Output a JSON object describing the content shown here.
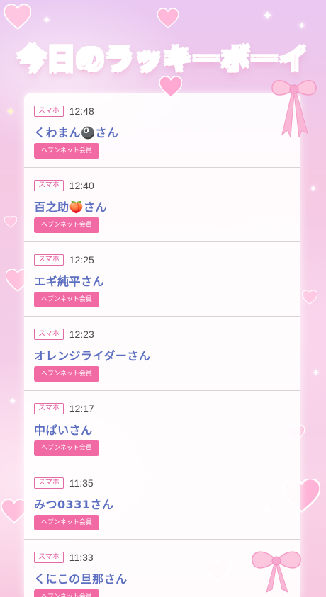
{
  "header": {
    "title": "今日のラッキーボーイ"
  },
  "entries": [
    {
      "device": "スマホ",
      "time": "12:48",
      "name": "くわまん🎱さん",
      "badge": "ヘブンネット会員"
    },
    {
      "device": "スマホ",
      "time": "12:40",
      "name": "百之助🍑さん",
      "badge": "ヘブンネット会員"
    },
    {
      "device": "スマホ",
      "time": "12:25",
      "name": "エギ純平さん",
      "badge": "ヘブンネット会員"
    },
    {
      "device": "スマホ",
      "time": "12:23",
      "name": "オレンジライダーさん",
      "badge": "ヘブンネット会員"
    },
    {
      "device": "スマホ",
      "time": "12:17",
      "name": "中ぱいさん",
      "badge": "ヘブンネット会員"
    },
    {
      "device": "スマホ",
      "time": "11:35",
      "name": "みつ0331さん",
      "badge": "ヘブンネット会員"
    },
    {
      "device": "スマホ",
      "time": "11:33",
      "name": "くにこの旦那さん",
      "badge": "ヘブンネット会員"
    }
  ],
  "colors": {
    "title": "#f27db5",
    "name": "#5c6fc0",
    "badge_bg": "#f26aa4",
    "device_border": "#e46aa6"
  },
  "decor": {
    "icons": [
      "heart-icon",
      "ribbon-bow-icon",
      "sparkle-icon"
    ]
  }
}
